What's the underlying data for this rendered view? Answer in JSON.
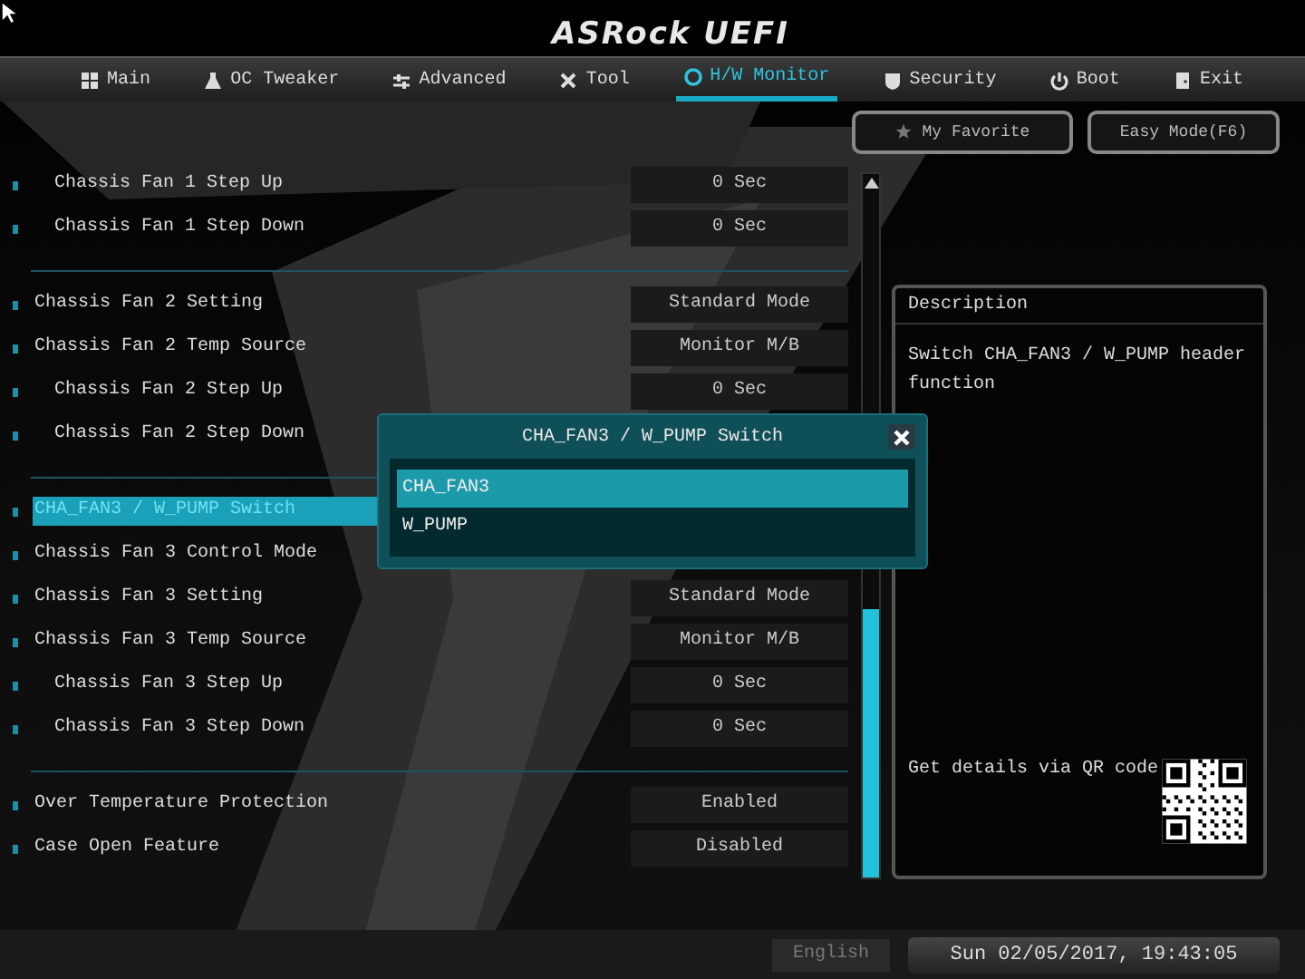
{
  "header": {
    "logo": "ASRock UEFI"
  },
  "tabs": [
    {
      "label": "Main",
      "selected": false
    },
    {
      "label": "OC Tweaker",
      "selected": false
    },
    {
      "label": "Advanced",
      "selected": false
    },
    {
      "label": "Tool",
      "selected": false
    },
    {
      "label": "H/W Monitor",
      "selected": true
    },
    {
      "label": "Security",
      "selected": false
    },
    {
      "label": "Boot",
      "selected": false
    },
    {
      "label": "Exit",
      "selected": false
    }
  ],
  "favorites": {
    "my_favorite": "My Favorite",
    "easy_mode": "Easy Mode(F6)"
  },
  "settings": [
    {
      "items": [
        {
          "kind": "sub",
          "label": "Chassis Fan 1 Step Up",
          "value": "0 Sec",
          "selected": false
        },
        {
          "kind": "sub",
          "label": "Chassis Fan 1 Step Down",
          "value": "0 Sec",
          "selected": false
        }
      ]
    },
    {
      "items": [
        {
          "kind": "item",
          "label": "Chassis Fan 2 Setting",
          "value": "Standard Mode",
          "selected": false
        },
        {
          "kind": "item",
          "label": "Chassis Fan 2 Temp Source",
          "value": "Monitor M/B",
          "selected": false
        },
        {
          "kind": "sub",
          "label": "Chassis Fan 2 Step Up",
          "value": "0 Sec",
          "selected": false
        },
        {
          "kind": "sub",
          "label": "Chassis Fan 2 Step Down",
          "selected": false
        }
      ]
    },
    {
      "items": [
        {
          "kind": "item",
          "label": "CHA_FAN3 / W_PUMP Switch",
          "selected": true
        },
        {
          "kind": "item",
          "label": "Chassis Fan 3 Control Mode",
          "selected": false
        },
        {
          "kind": "item",
          "label": "Chassis Fan 3 Setting",
          "value": "Standard Mode",
          "selected": false
        },
        {
          "kind": "item",
          "label": "Chassis Fan 3 Temp Source",
          "value": "Monitor M/B",
          "selected": false
        },
        {
          "kind": "sub",
          "label": "Chassis Fan 3 Step Up",
          "value": "0 Sec",
          "selected": false
        },
        {
          "kind": "sub",
          "label": "Chassis Fan 3 Step Down",
          "value": "0 Sec",
          "selected": false
        }
      ]
    },
    {
      "items": [
        {
          "kind": "item",
          "label": "Over Temperature Protection",
          "value": "Enabled",
          "selected": false
        },
        {
          "kind": "item",
          "label": "Case Open Feature",
          "value": "Disabled",
          "selected": false
        }
      ]
    }
  ],
  "description": {
    "title": "Description",
    "text": "Switch CHA_FAN3 / W_PUMP header function",
    "qr_label": "Get details via QR code"
  },
  "popup": {
    "title": "CHA_FAN3 / W_PUMP Switch",
    "options": [
      {
        "label": "CHA_FAN3",
        "selected": true
      },
      {
        "label": "W_PUMP",
        "selected": false
      }
    ]
  },
  "status_bar": {
    "language": "English",
    "datetime": "Sun 02/05/2017, 19:43:05"
  }
}
